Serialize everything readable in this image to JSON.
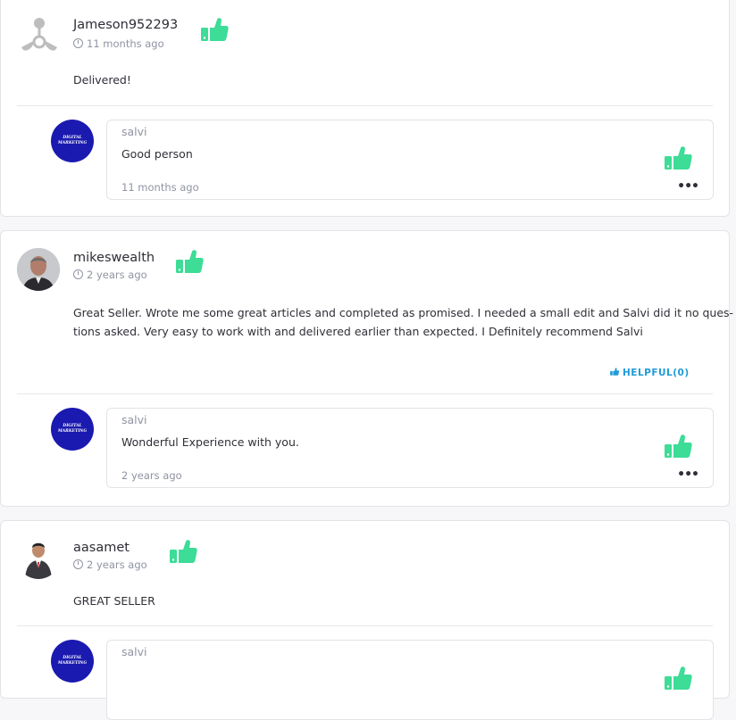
{
  "reviews": [
    {
      "name": "Jameson952293",
      "time": "11 months ago",
      "text": "Delivered!",
      "reply": {
        "name": "salvi",
        "text": "Good person",
        "time": "11 months ago",
        "avatar_text": "DIGITAL MARKETING"
      }
    },
    {
      "name": "mikeswealth",
      "time": "2 years ago",
      "text_lines": [
        "Great Seller. Wrote me some great articles and completed as promised. I needed a small edit and Salvi did it no ques-",
        "tions asked. Very easy to work with and delivered earlier than expected. I Definitely recommend Salvi"
      ],
      "helpful": "HELPFUL(0)",
      "reply": {
        "name": "salvi",
        "text": "Wonderful Experience with you.",
        "time": "2 years ago",
        "avatar_text": "DIGITAL MARKETING"
      }
    },
    {
      "name": "aasamet",
      "time": "2 years ago",
      "text": "GREAT SELLER",
      "reply": {
        "name": "salvi",
        "avatar_text": "DIGITAL MARKETING"
      }
    }
  ],
  "colors": {
    "thumb": "#3ddc97",
    "helpful": "#1f9bd9",
    "reply_avatar": "#1a1ab0"
  },
  "icons": {
    "positive_rating": "thumbs-up-icon",
    "time": "clock-icon",
    "more": "more-options-icon"
  }
}
